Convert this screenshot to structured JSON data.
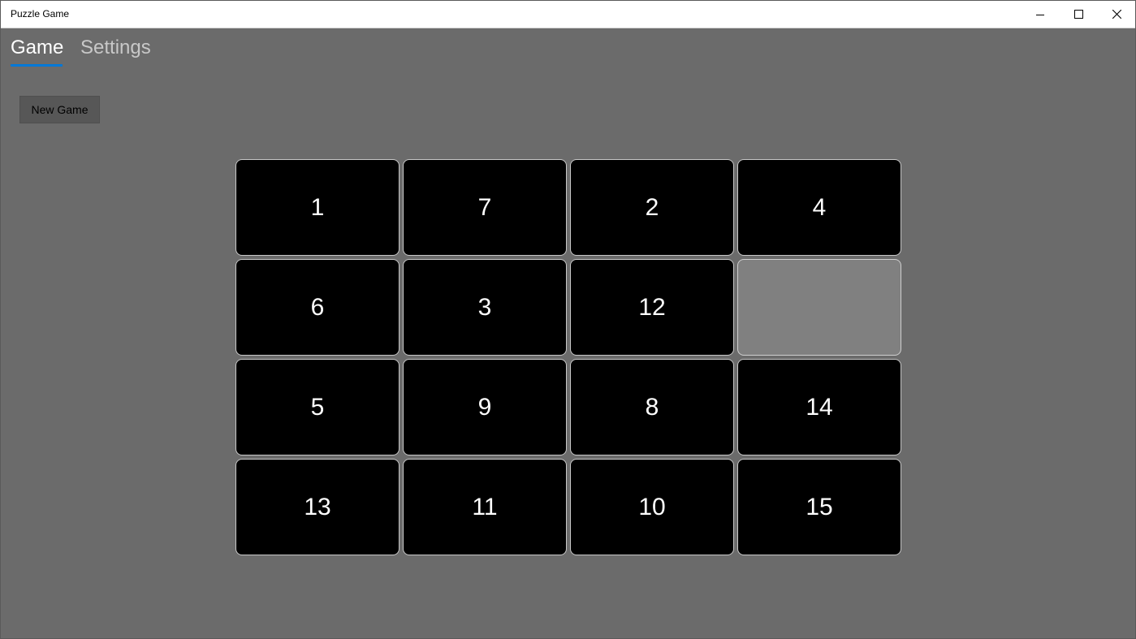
{
  "window": {
    "title": "Puzzle Game"
  },
  "titlebar": {
    "minimize_icon": "minimize-icon",
    "maximize_icon": "maximize-icon",
    "close_icon": "close-icon"
  },
  "tabs": [
    {
      "label": "Game",
      "selected": true
    },
    {
      "label": "Settings",
      "selected": false
    }
  ],
  "actions": {
    "new_game_label": "New Game"
  },
  "board": {
    "rows": 4,
    "cols": 4,
    "tiles": [
      "1",
      "7",
      "2",
      "4",
      "6",
      "3",
      "12",
      "",
      "5",
      "9",
      "8",
      "14",
      "13",
      "11",
      "10",
      "15"
    ]
  },
  "colors": {
    "background": "#6b6b6b",
    "tile": "#000000",
    "tile_text": "#ffffff",
    "empty_tile": "#808080",
    "tab_accent": "#0078d7"
  }
}
